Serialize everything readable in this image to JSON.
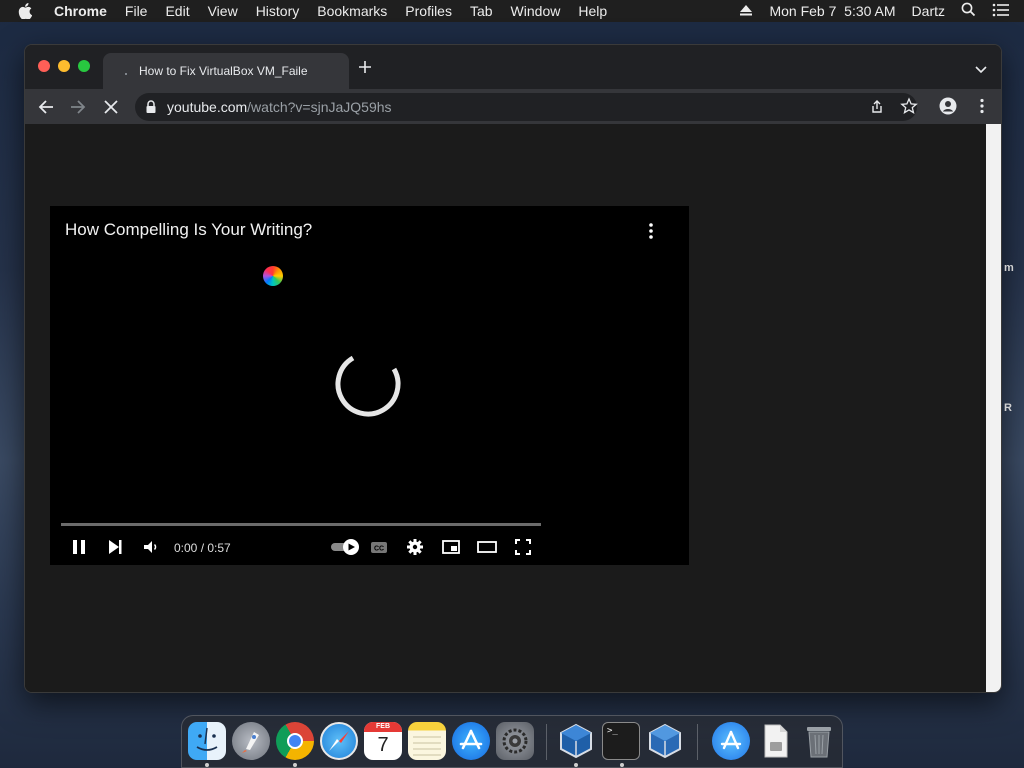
{
  "menubar": {
    "app_name": "Chrome",
    "items": [
      "File",
      "Edit",
      "View",
      "History",
      "Bookmarks",
      "Profiles",
      "Tab",
      "Window",
      "Help"
    ],
    "datetime": "Mon Feb 7  5:30 AM",
    "user": "Dartz"
  },
  "browser": {
    "tab_title": "How to Fix VirtualBox VM_Faile",
    "url_host": "youtube.com",
    "url_path": "/watch?v=sjnJaJQ59hs"
  },
  "player": {
    "video_title": "How Compelling Is Your Writing?",
    "time_display": "0:00 / 0:57",
    "progress": 0.0,
    "autoplay_on": true
  },
  "desktop_edge": {
    "letter_1": "m",
    "letter_2": "R"
  },
  "dock": {
    "apps": [
      "finder-icon",
      "launchpad-icon",
      "chrome-icon",
      "safari-icon",
      "calendar-icon",
      "notes-icon",
      "app-store-icon",
      "system-preferences-icon",
      "virtualbox-icon",
      "terminal-icon",
      "virtualbox-vm-icon",
      "app-store-downloads-icon",
      "document-icon",
      "trash-icon"
    ],
    "calendar_month": "FEB",
    "calendar_day": "7",
    "terminal_prompt": ">_"
  },
  "colors": {
    "accent_red": "#ff5f57",
    "accent_yellow": "#febc2e",
    "accent_green": "#28c840",
    "toolbar": "#35363a",
    "omnibox": "#202124"
  }
}
